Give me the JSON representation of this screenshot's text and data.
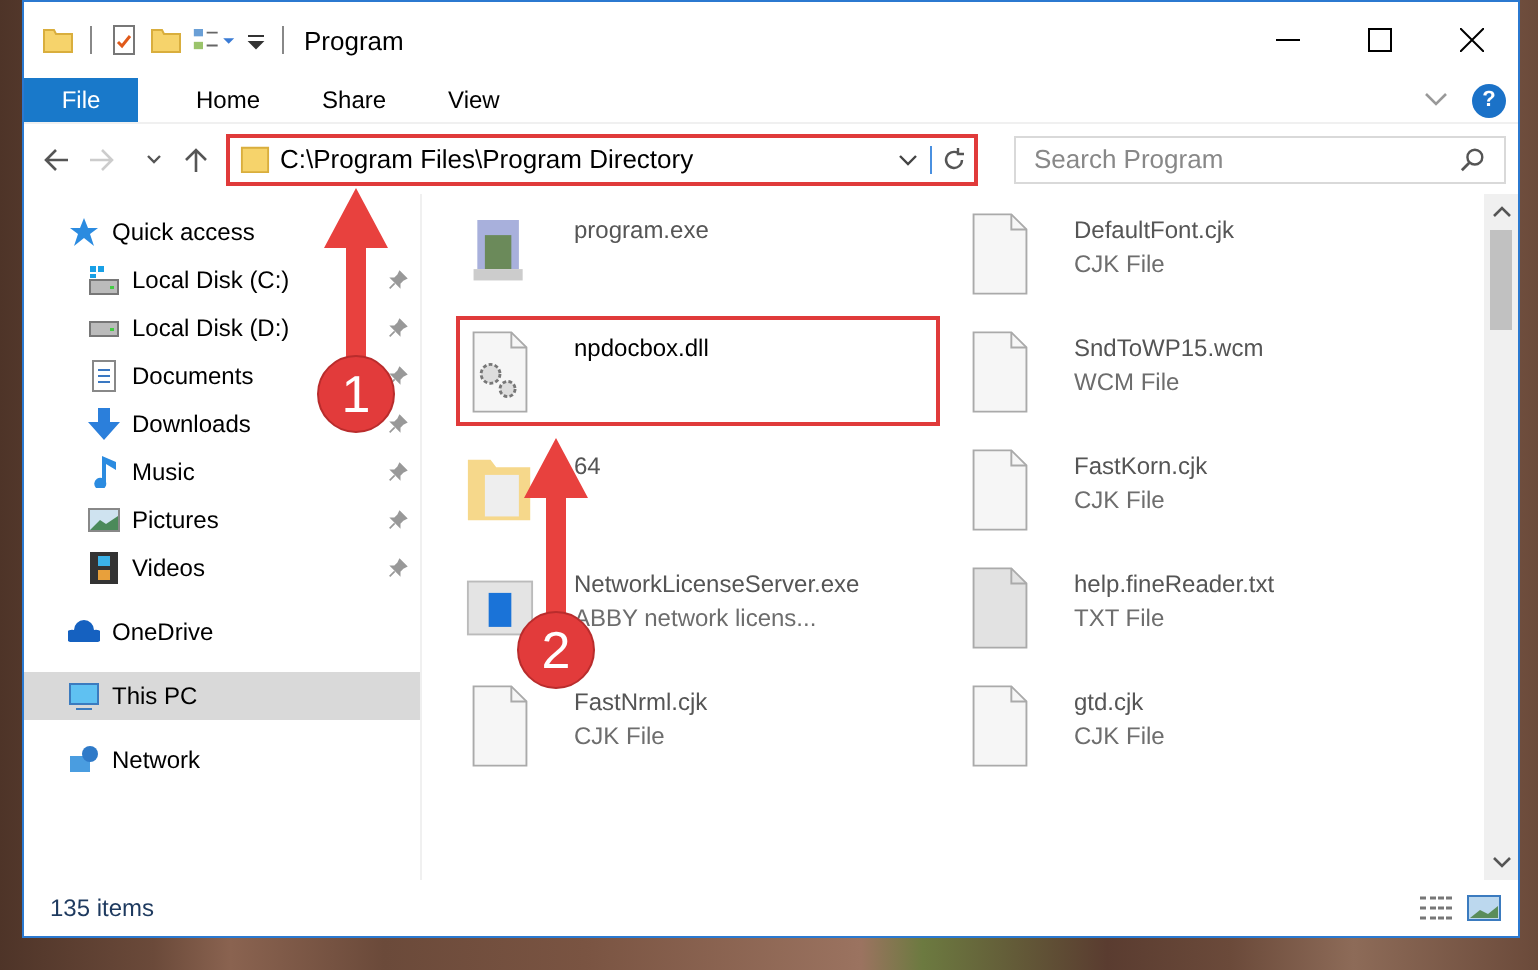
{
  "window": {
    "title": "Program"
  },
  "ribbon": {
    "tabs": [
      {
        "label": "File",
        "kind": "file"
      },
      {
        "label": "Home",
        "kind": "plain"
      },
      {
        "label": "Share",
        "kind": "plain"
      },
      {
        "label": "View",
        "kind": "plain"
      }
    ],
    "help": "?"
  },
  "address": {
    "path": "C:\\Program Files\\Program Directory",
    "highlighted": true
  },
  "search": {
    "placeholder": "Search Program"
  },
  "sidebar": {
    "items": [
      {
        "label": "Quick access",
        "selected": false,
        "children": [
          {
            "label": "Local Disk (C:)",
            "pinned": true
          },
          {
            "label": "Local Disk (D:)",
            "pinned": true
          },
          {
            "label": "Documents",
            "pinned": true
          },
          {
            "label": "Downloads",
            "pinned": true
          },
          {
            "label": "Music",
            "pinned": true
          },
          {
            "label": "Pictures",
            "pinned": true
          },
          {
            "label": "Videos",
            "pinned": true
          }
        ]
      },
      {
        "label": "OneDrive",
        "selected": false
      },
      {
        "label": "This PC",
        "selected": true
      },
      {
        "label": "Network",
        "selected": false
      }
    ]
  },
  "files": [
    {
      "name": "program.exe",
      "highlighted": false
    },
    {
      "name": "DefaultFont.cjk",
      "type": "CJK File",
      "highlighted": false
    },
    {
      "name": "npdocbox.dll",
      "highlighted": true
    },
    {
      "name": "SndToWP15.wcm",
      "type": "WCM File",
      "highlighted": false
    },
    {
      "name": "64",
      "highlighted": false
    },
    {
      "name": "FastKorn.cjk",
      "type": "CJK File",
      "highlighted": false
    },
    {
      "name": "NetworkLicenseServer.exe",
      "type": "ABBY network licens...",
      "highlighted": false
    },
    {
      "name": "help.fineReader.txt",
      "type": "TXT File",
      "highlighted": false
    },
    {
      "name": "FastNrml.cjk",
      "type": "CJK File",
      "highlighted": false
    },
    {
      "name": "gtd.cjk",
      "type": "CJK File",
      "highlighted": false
    }
  ],
  "status_bar": {
    "items": "135 items"
  },
  "annotations": [
    {
      "label": "1"
    },
    {
      "label": "2"
    }
  ]
}
